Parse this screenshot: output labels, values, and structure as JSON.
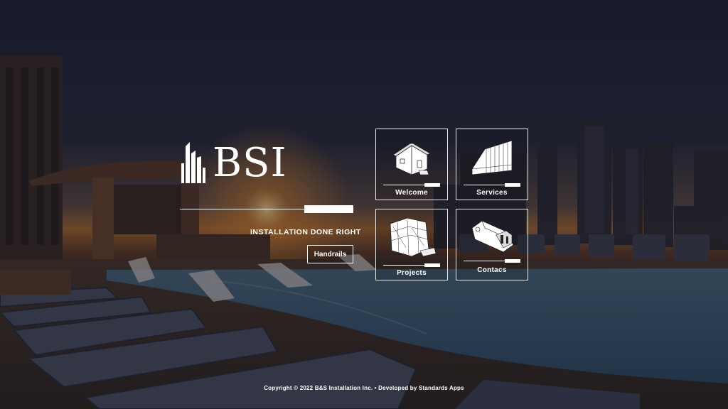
{
  "brand": {
    "logo_text": "BSI",
    "tagline": "INSTALLATION DONE RIGHT",
    "handrails_label": "Handrails"
  },
  "tiles": [
    {
      "label": "Welcome",
      "icon": "house-sketch-icon"
    },
    {
      "label": "Services",
      "icon": "wall-panel-sketch-icon"
    },
    {
      "label": "Projects",
      "icon": "building-frame-sketch-icon"
    },
    {
      "label": "Contacs",
      "icon": "machine-sketch-icon"
    }
  ],
  "footer": {
    "copyright": "Copyright © 2022 B&S Installation Inc. • Developed by Standards Apps"
  },
  "colors": {
    "sky_top": "#262a3c",
    "sunset": "#c97a2c",
    "pool": "#3b5a73",
    "deck": "#4a3a30"
  }
}
